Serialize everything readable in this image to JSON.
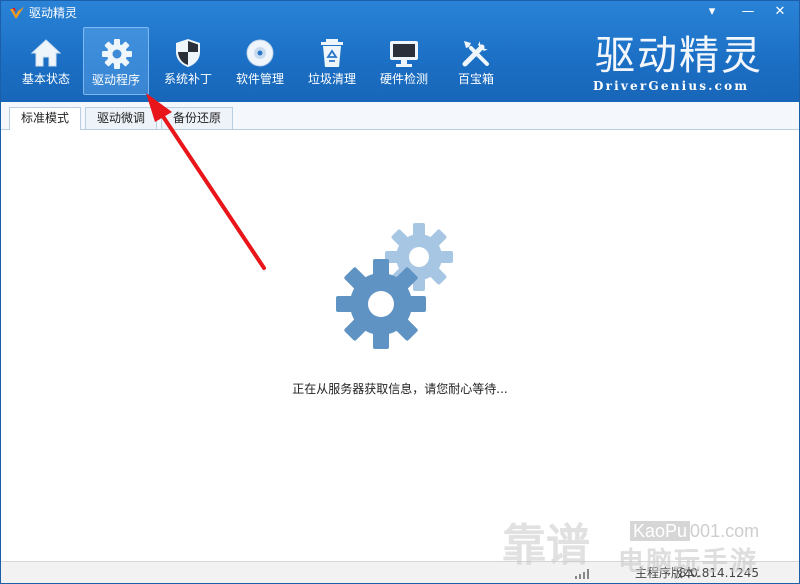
{
  "app": {
    "title": "驱动精灵",
    "brand_cn": "驱动精灵",
    "brand_en": "DriverGenius.com"
  },
  "window_buttons": {
    "menu": "▾",
    "minimize": "—",
    "close": "✕"
  },
  "toolbar": {
    "items": [
      {
        "label": "基本状态",
        "icon": "house-icon"
      },
      {
        "label": "驱动程序",
        "icon": "gear-icon",
        "active": true
      },
      {
        "label": "系统补丁",
        "icon": "shield-icon"
      },
      {
        "label": "软件管理",
        "icon": "disc-icon"
      },
      {
        "label": "垃圾清理",
        "icon": "recycle-bin-icon"
      },
      {
        "label": "硬件检测",
        "icon": "monitor-icon"
      },
      {
        "label": "百宝箱",
        "icon": "tools-icon"
      }
    ]
  },
  "tabs": [
    {
      "label": "标准模式",
      "active": true
    },
    {
      "label": "驱动微调"
    },
    {
      "label": "备份还原"
    }
  ],
  "main": {
    "loading_text": "正在从服务器获取信息，请您耐心等待..."
  },
  "statusbar": {
    "version_label": "主程序版本：",
    "version_value": "8.0.814.1245"
  },
  "watermark": {
    "site": "KaoPu",
    "domain": "001.com",
    "big_text": "靠谱",
    "sub_text": "电脑玩手游"
  },
  "colors": {
    "header_blue": "#1b6fc4",
    "accent_red": "#e8151b",
    "gear_dark": "#5b8fc0",
    "gear_light": "#9dc0e0"
  }
}
